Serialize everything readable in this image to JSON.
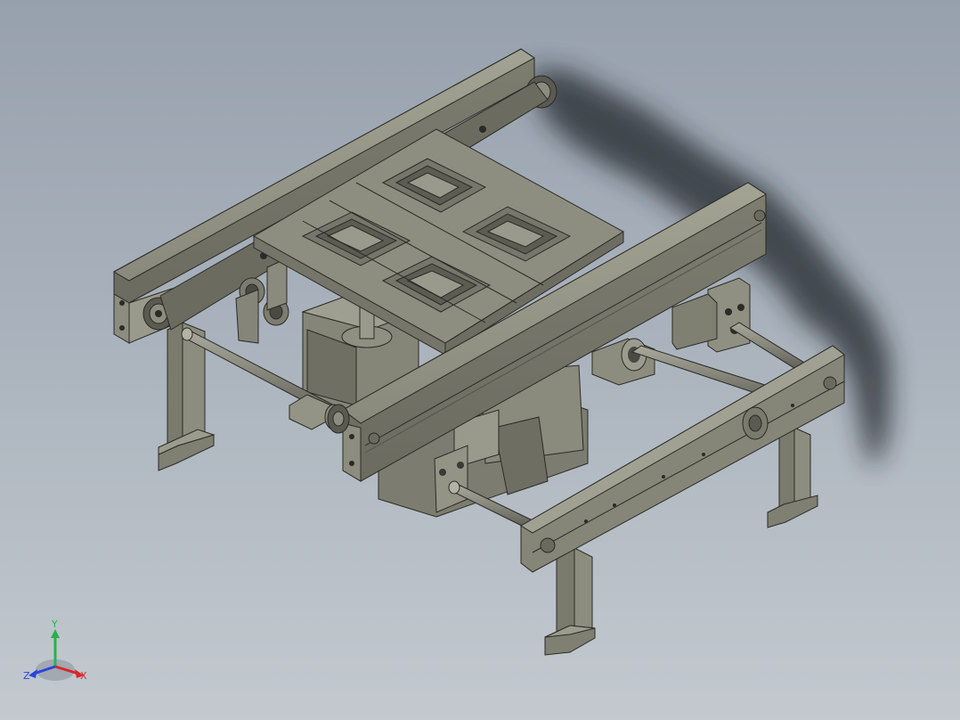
{
  "viewport": {
    "background_top": "#97a1ad",
    "background_bottom": "#c3c9cf",
    "model_color": "#8c8c7e",
    "edge_color": "#2b2b27",
    "shadow_color": "#1e2328"
  },
  "triad": {
    "x_label": "X",
    "y_label": "Y",
    "z_label": "Z",
    "x_color": "#d8262a",
    "y_color": "#26b34a",
    "z_color": "#2b46d8"
  }
}
